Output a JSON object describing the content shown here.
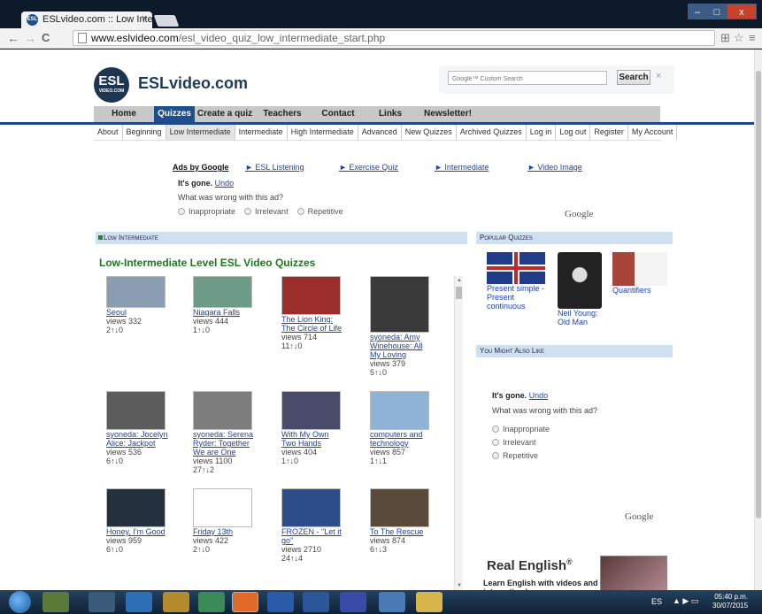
{
  "browser": {
    "tab_title": "ESLvideo.com :: Low Interr",
    "tab_favicon": "ESL",
    "tab_close": "×",
    "url_domain": "www.eslvideo.com",
    "url_path": "/esl_video_quiz_low_intermediate_start.php",
    "back_glyph": "←",
    "forward_glyph": "→",
    "reload_glyph": "C",
    "star_glyph": "☆",
    "menu_glyph": "≡",
    "translate_glyph": "⊞",
    "win_min": "–",
    "win_max": "□",
    "win_close": "x"
  },
  "header": {
    "logo_letters": "ESL",
    "logo_small": "VIDEO.COM",
    "site_name": "ESLvideo.com",
    "search_placeholder": "Google™ Custom Search",
    "search_button": "Search",
    "search_clear": "×"
  },
  "nav": {
    "items": [
      "Home",
      "Quizzes",
      "Create a quiz",
      "Teachers",
      "Contact",
      "Links",
      "Newsletter!"
    ],
    "active_index": 1
  },
  "subnav": {
    "items": [
      "About",
      "Beginning",
      "Low Intermediate",
      "Intermediate",
      "High Intermediate",
      "Advanced",
      "New Quizzes",
      "Archived Quizzes",
      "Log in",
      "Log out",
      "Register",
      "My Account"
    ],
    "active_index": 2
  },
  "ads": {
    "ads_by_google": "Ads by Google",
    "links": [
      "► ESL Listening",
      "► Exercise Quiz",
      "► Intermediate",
      "► Video Image"
    ],
    "gone_text": "It's gone.",
    "undo": "Undo",
    "question": "What was wrong with this ad?",
    "options": [
      "Inappropriate",
      "Irrelevant",
      "Repetitive"
    ],
    "google": "Google"
  },
  "left": {
    "section_label": "Low Intermediate",
    "title": "Low-Intermediate Level ESL Video Quizzes",
    "quizzes": [
      {
        "title": "Seoul",
        "views": "views 332",
        "votes": "2↑↓0",
        "thumb": "#8a9db3"
      },
      {
        "title": "Niagara Falls",
        "views": "views 444",
        "votes": "1↑↓0",
        "thumb": "#6e9a88"
      },
      {
        "title": "The Lion King: The Circle of Life",
        "views": "views 714",
        "votes": "11↑↓0",
        "thumb": "#9b2d2a"
      },
      {
        "title": "syoneda: Amy Winehouse: All My Loving",
        "views": "views 379",
        "votes": "5↑↓0",
        "thumb": "#3a3a3a"
      },
      {
        "title": "syoneda: Jocelyn Alice: Jackpot",
        "views": "views 536",
        "votes": "6↑↓0",
        "thumb": "#5c5c5c"
      },
      {
        "title": "syoneda: Serena Ryder: Together We are One",
        "views": "views 1100",
        "votes": "27↑↓2",
        "thumb": "#7d7d7d"
      },
      {
        "title": "With My Own Two Hands",
        "views": "views 404",
        "votes": "1↑↓0",
        "thumb": "#4a4a6a"
      },
      {
        "title": "computers and technology",
        "views": "views 857",
        "votes": "1↑↓1",
        "thumb": "#8fb3d6"
      },
      {
        "title": "Honey, I'm Good",
        "views": "views 959",
        "votes": "6↑↓0",
        "thumb": "#23303e"
      },
      {
        "title": "Friday 13th",
        "views": "views 422",
        "votes": "2↑↓0",
        "thumb": "#ffffff"
      },
      {
        "title": "FROZEN - \"Let it go\"",
        "views": "views 2710",
        "votes": "24↑↓4",
        "thumb": "#2d4e8a"
      },
      {
        "title": "To The Rescue",
        "views": "views 874",
        "votes": "6↑↓3",
        "thumb": "#5a4a3a"
      }
    ]
  },
  "right": {
    "popular_label": "Popular Quizzes",
    "popular": [
      {
        "title": "Present simple - Present continuous",
        "thumb": "#c0282d"
      },
      {
        "title": "Neil Young: Old Man",
        "thumb": "#2a2a2a"
      },
      {
        "title": "Quantifiers",
        "thumb": "#a8453a"
      }
    ],
    "might_label": "You Might Also Like",
    "gone_text": "It's gone.",
    "undo": "Undo",
    "question": "What was wrong with this ad?",
    "options": [
      "Inappropriate",
      "Irrelevant",
      "Repetitive"
    ],
    "google": "Google",
    "real_title": "Real English",
    "real_reg": "®",
    "real_sub": "Learn English with videos and interactive lessons"
  },
  "taskbar": {
    "lang": "ES",
    "tray": "▲ ▶ ▭",
    "time": "05:40 p.m.",
    "date": "30/07/2015"
  }
}
